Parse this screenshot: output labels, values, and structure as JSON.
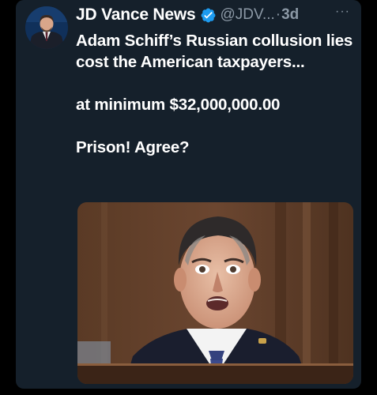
{
  "tweet": {
    "author": {
      "display_name": "JD Vance News",
      "handle": "@JDV...",
      "verified": true,
      "avatar_icon": "avatar-photo"
    },
    "separator": "·",
    "timestamp": "3d",
    "more_label": "···",
    "text": {
      "line1": "Adam Schiff’s Russian collusion lies cost the American taxpayers...",
      "line2": "at minimum $32,000,000.00",
      "line3": "Prison!  Agree?"
    },
    "media": {
      "description_icon": "photo"
    }
  },
  "colors": {
    "background": "#000000",
    "card": "#15202b",
    "text": "#ffffff",
    "secondary": "#8b98a5",
    "verified_badge": "#1d9bf0"
  }
}
